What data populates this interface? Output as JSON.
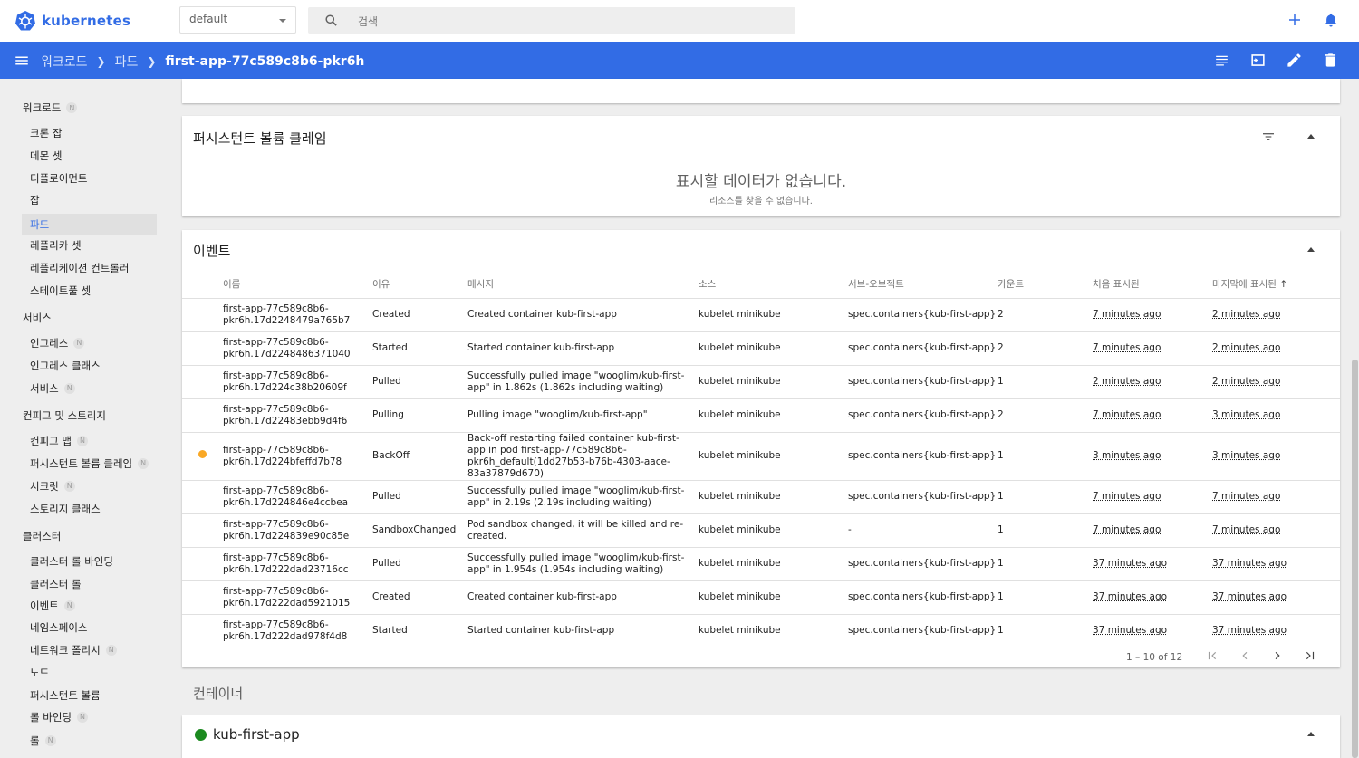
{
  "app": {
    "brand": "kubernetes"
  },
  "topbar": {
    "namespace": "default",
    "search_placeholder": "검색"
  },
  "breadcrumb": {
    "items": [
      "워크로드",
      "파드"
    ],
    "current": "first-app-77c589c8b6-pkr6h"
  },
  "sidebar": {
    "groups": [
      {
        "label": "워크로드",
        "badge": "N"
      },
      {
        "label": "서비스"
      },
      {
        "label": "컨피그 및 스토리지"
      },
      {
        "label": "클러스터"
      }
    ],
    "items": [
      {
        "label": "크론 잡"
      },
      {
        "label": "데몬 셋"
      },
      {
        "label": "디플로이먼트"
      },
      {
        "label": "잡"
      },
      {
        "label": "파드",
        "active": true
      },
      {
        "label": "레플리카 셋"
      },
      {
        "label": "레플리케이션 컨트롤러"
      },
      {
        "label": "스테이트풀 셋"
      },
      {
        "label": "인그레스",
        "badge": "N"
      },
      {
        "label": "인그레스 클래스"
      },
      {
        "label": "서비스",
        "badge": "N"
      },
      {
        "label": "컨피그 맵",
        "badge": "N"
      },
      {
        "label": "퍼시스턴트 볼륨 클레임",
        "badge": "N"
      },
      {
        "label": "시크릿",
        "badge": "N"
      },
      {
        "label": "스토리지 클래스"
      },
      {
        "label": "클러스터 롤 바인딩"
      },
      {
        "label": "클러스터 롤"
      },
      {
        "label": "이벤트",
        "badge": "N"
      },
      {
        "label": "네임스페이스"
      },
      {
        "label": "네트워크 폴리시",
        "badge": "N"
      },
      {
        "label": "노드"
      },
      {
        "label": "퍼시스턴트 볼륨"
      },
      {
        "label": "롤 바인딩",
        "badge": "N"
      },
      {
        "label": "롤",
        "badge": "N"
      }
    ]
  },
  "pvc_card": {
    "title": "퍼시스턴트 볼륨 클레임",
    "empty_title": "표시할 데이터가 없습니다.",
    "empty_sub": "리소스를 찾을 수 없습니다."
  },
  "events_card": {
    "title": "이벤트",
    "columns": [
      "이름",
      "이유",
      "메시지",
      "소스",
      "서브-오브젝트",
      "카운트",
      "처음 표시된",
      "마지막에 표시된"
    ],
    "rows": [
      {
        "warning": false,
        "name": "first-app-77c589c8b6-pkr6h.17d2248479a765b7",
        "reason": "Created",
        "message": "Created container kub-first-app",
        "source": "kubelet minikube",
        "subobject": "spec.containers{kub-first-app}",
        "count": "2",
        "first": "7 minutes ago",
        "last": "2 minutes ago"
      },
      {
        "warning": false,
        "name": "first-app-77c589c8b6-pkr6h.17d2248486371040",
        "reason": "Started",
        "message": "Started container kub-first-app",
        "source": "kubelet minikube",
        "subobject": "spec.containers{kub-first-app}",
        "count": "2",
        "first": "7 minutes ago",
        "last": "2 minutes ago"
      },
      {
        "warning": false,
        "name": "first-app-77c589c8b6-pkr6h.17d224c38b20609f",
        "reason": "Pulled",
        "message": "Successfully pulled image \"wooglim/kub-first-app\" in 1.862s (1.862s including waiting)",
        "source": "kubelet minikube",
        "subobject": "spec.containers{kub-first-app}",
        "count": "1",
        "first": "2 minutes ago",
        "last": "2 minutes ago"
      },
      {
        "warning": false,
        "name": "first-app-77c589c8b6-pkr6h.17d22483ebb9d4f6",
        "reason": "Pulling",
        "message": "Pulling image \"wooglim/kub-first-app\"",
        "source": "kubelet minikube",
        "subobject": "spec.containers{kub-first-app}",
        "count": "2",
        "first": "7 minutes ago",
        "last": "3 minutes ago"
      },
      {
        "warning": true,
        "name": "first-app-77c589c8b6-pkr6h.17d224bfeffd7b78",
        "reason": "BackOff",
        "message": "Back-off restarting failed container kub-first-app in pod first-app-77c589c8b6-pkr6h_default(1dd27b53-b76b-4303-aace-83a37879d670)",
        "source": "kubelet minikube",
        "subobject": "spec.containers{kub-first-app}",
        "count": "1",
        "first": "3 minutes ago",
        "last": "3 minutes ago"
      },
      {
        "warning": false,
        "name": "first-app-77c589c8b6-pkr6h.17d224846e4ccbea",
        "reason": "Pulled",
        "message": "Successfully pulled image \"wooglim/kub-first-app\" in 2.19s (2.19s including waiting)",
        "source": "kubelet minikube",
        "subobject": "spec.containers{kub-first-app}",
        "count": "1",
        "first": "7 minutes ago",
        "last": "7 minutes ago"
      },
      {
        "warning": false,
        "name": "first-app-77c589c8b6-pkr6h.17d224839e90c85e",
        "reason": "SandboxChanged",
        "message": "Pod sandbox changed, it will be killed and re-created.",
        "source": "kubelet minikube",
        "subobject": "-",
        "count": "1",
        "first": "7 minutes ago",
        "last": "7 minutes ago"
      },
      {
        "warning": false,
        "name": "first-app-77c589c8b6-pkr6h.17d222dad23716cc",
        "reason": "Pulled",
        "message": "Successfully pulled image \"wooglim/kub-first-app\" in 1.954s (1.954s including waiting)",
        "source": "kubelet minikube",
        "subobject": "spec.containers{kub-first-app}",
        "count": "1",
        "first": "37 minutes ago",
        "last": "37 minutes ago"
      },
      {
        "warning": false,
        "name": "first-app-77c589c8b6-pkr6h.17d222dad5921015",
        "reason": "Created",
        "message": "Created container kub-first-app",
        "source": "kubelet minikube",
        "subobject": "spec.containers{kub-first-app}",
        "count": "1",
        "first": "37 minutes ago",
        "last": "37 minutes ago"
      },
      {
        "warning": false,
        "name": "first-app-77c589c8b6-pkr6h.17d222dad978f4d8",
        "reason": "Started",
        "message": "Started container kub-first-app",
        "source": "kubelet minikube",
        "subobject": "spec.containers{kub-first-app}",
        "count": "1",
        "first": "37 minutes ago",
        "last": "37 minutes ago"
      }
    ],
    "pagination": "1 – 10 of 12"
  },
  "containers_section": {
    "title": "컨테이너"
  },
  "container_card": {
    "name": "kub-first-app"
  },
  "colors": {
    "primary": "#326ce5",
    "warning": "#f9a825",
    "running": "#1b8a1f"
  }
}
